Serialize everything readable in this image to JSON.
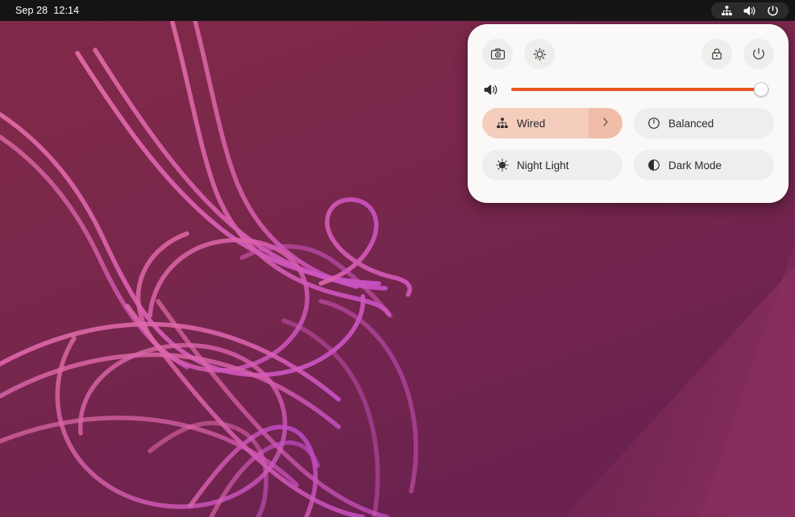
{
  "topbar": {
    "clock": "Sep 28  12:14",
    "tray": [
      {
        "name": "wired-network-icon",
        "label": "Wired network"
      },
      {
        "name": "volume-icon",
        "label": "Volume"
      },
      {
        "name": "power-icon",
        "label": "Power"
      }
    ]
  },
  "quick_settings": {
    "actions": [
      {
        "name": "screenshot-button",
        "label": "Take Screenshot"
      },
      {
        "name": "settings-button",
        "label": "Settings"
      },
      {
        "name": "lock-button",
        "label": "Lock Screen"
      },
      {
        "name": "power-button",
        "label": "Power Off / Log Out"
      }
    ],
    "volume": {
      "icon_label": "Volume",
      "value": 97,
      "fill_color": "#e8561f",
      "track_color": "#d4d1ce"
    },
    "tiles": [
      {
        "name": "wired-tile",
        "label": "Wired",
        "icon": "wired-network-icon",
        "active": true,
        "has_submenu": true,
        "submenu_icon": "chevron-right-icon",
        "active_color": "#f5cdbd"
      },
      {
        "name": "power-mode-tile",
        "label": "Balanced",
        "icon": "power-profile-icon",
        "active": false,
        "has_submenu": false
      },
      {
        "name": "night-light-tile",
        "label": "Night Light",
        "icon": "night-light-icon",
        "active": false,
        "has_submenu": false
      },
      {
        "name": "dark-mode-tile",
        "label": "Dark Mode",
        "icon": "dark-mode-icon",
        "active": false,
        "has_submenu": false
      }
    ]
  },
  "desktop": {
    "wallpaper_name": "ubuntu-flowing-lines",
    "background_top": "#7a2745",
    "background_bottom": "#6e2450",
    "accent_line": "#e66bb8"
  }
}
